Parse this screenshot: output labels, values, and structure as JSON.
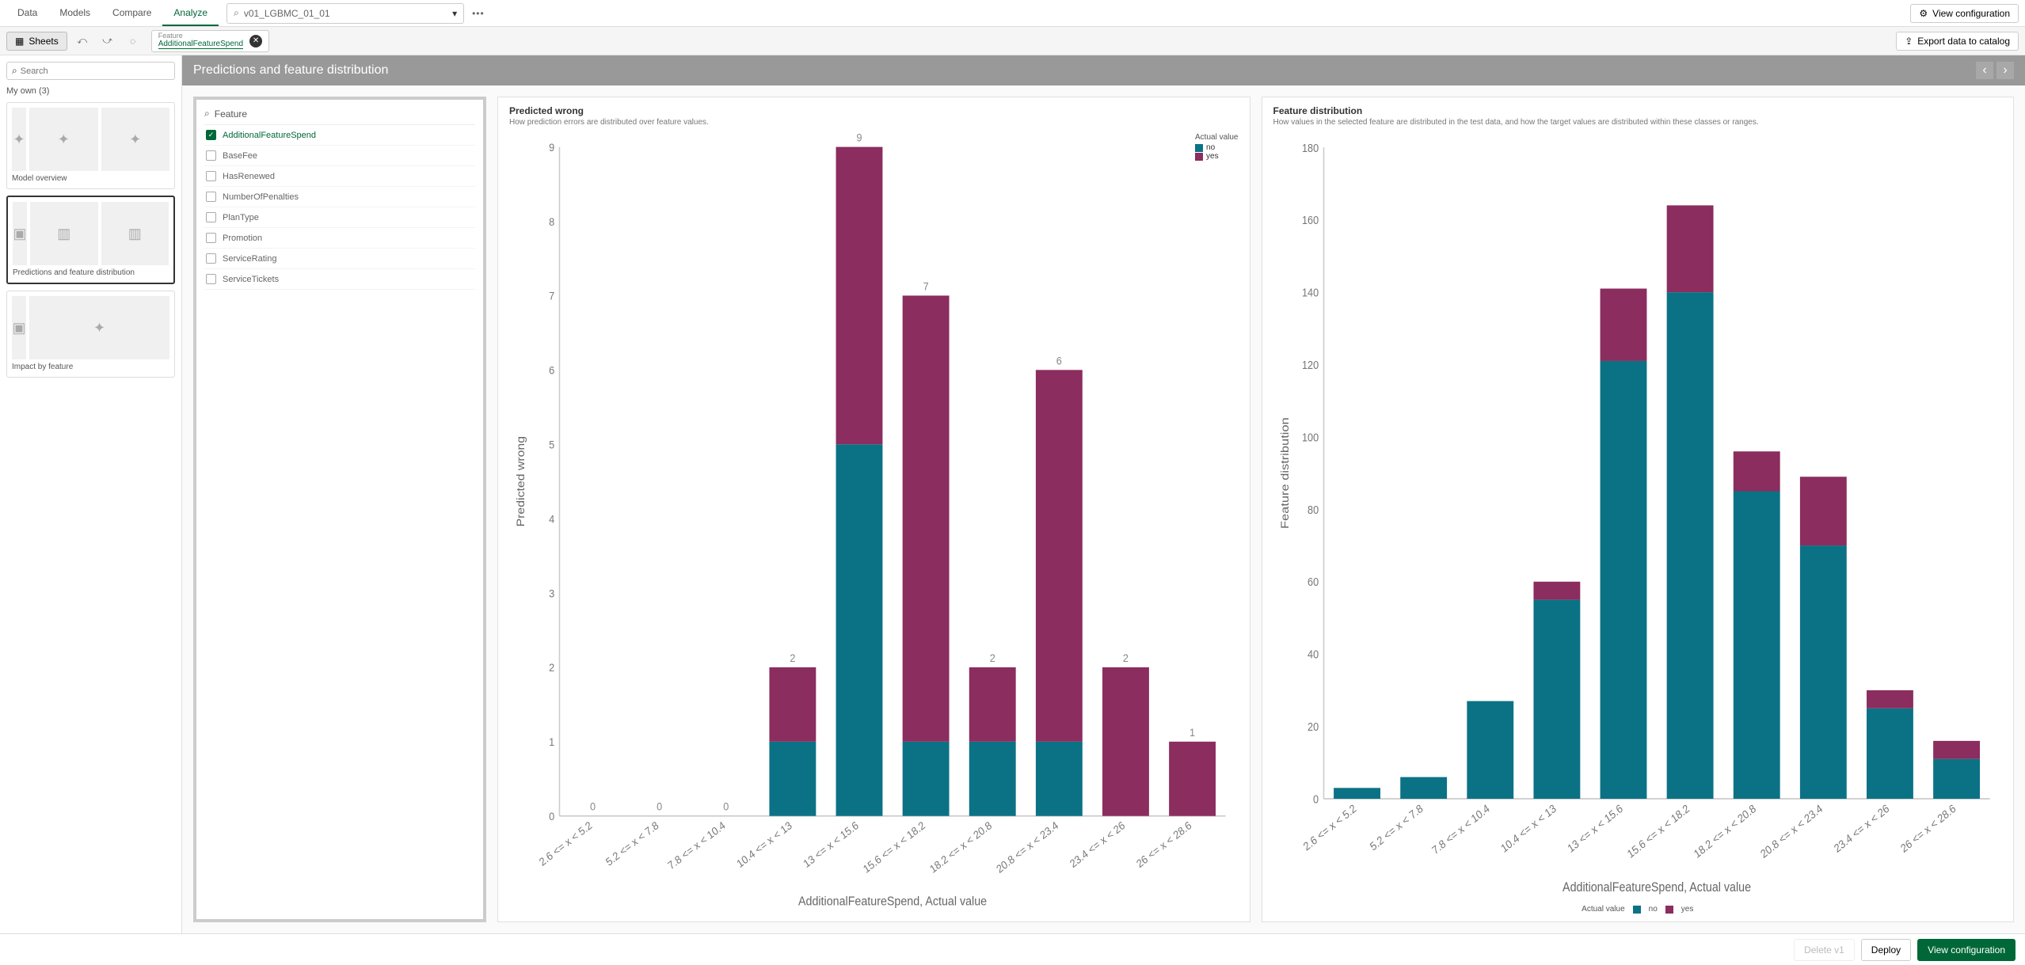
{
  "top_tabs": [
    "Data",
    "Models",
    "Compare",
    "Analyze"
  ],
  "active_top_tab": 3,
  "model_selector_value": "v01_LGBMC_01_01",
  "view_config_label": "View configuration",
  "sheets_btn_label": "Sheets",
  "feature_chip": {
    "label": "Feature",
    "value": "AdditionalFeatureSpend"
  },
  "export_label": "Export data to catalog",
  "search_placeholder": "Search",
  "myown_label": "My own (3)",
  "sheet_cards": [
    {
      "title": "Model overview"
    },
    {
      "title": "Predictions and feature distribution"
    },
    {
      "title": "Impact by feature"
    }
  ],
  "active_sheet": 1,
  "page_title": "Predictions and feature distribution",
  "feature_panel_header": "Feature",
  "features": [
    {
      "name": "AdditionalFeatureSpend",
      "checked": true
    },
    {
      "name": "BaseFee",
      "checked": false
    },
    {
      "name": "HasRenewed",
      "checked": false
    },
    {
      "name": "NumberOfPenalties",
      "checked": false
    },
    {
      "name": "PlanType",
      "checked": false
    },
    {
      "name": "Promotion",
      "checked": false
    },
    {
      "name": "ServiceRating",
      "checked": false
    },
    {
      "name": "ServiceTickets",
      "checked": false
    }
  ],
  "chart1": {
    "title": "Predicted wrong",
    "subtitle": "How prediction errors are distributed over feature values.",
    "legend_title": "Actual value",
    "xlabel": "AdditionalFeatureSpend, Actual value",
    "ylabel": "Predicted wrong"
  },
  "chart2": {
    "title": "Feature distribution",
    "subtitle": "How values in the selected feature are distributed in the test data, and how the target values are distributed within these classes or ranges.",
    "legend_title": "Actual value",
    "xlabel": "AdditionalFeatureSpend, Actual value",
    "ylabel": "Feature distribution"
  },
  "legend_items": [
    {
      "key": "no",
      "label": "no",
      "color": "#0b7285"
    },
    {
      "key": "yes",
      "label": "yes",
      "color": "#8b2d5e"
    }
  ],
  "footer": {
    "delete": "Delete v1",
    "deploy": "Deploy",
    "view_config": "View configuration"
  },
  "chart_data": [
    {
      "type": "bar",
      "title": "Predicted wrong",
      "xlabel": "AdditionalFeatureSpend, Actual value",
      "ylabel": "Predicted wrong",
      "ylim": [
        0,
        9
      ],
      "categories": [
        "2.6 <= x < 5.2",
        "5.2 <= x < 7.8",
        "7.8 <= x < 10.4",
        "10.4 <= x < 13",
        "13 <= x < 15.6",
        "15.6 <= x < 18.2",
        "18.2 <= x < 20.8",
        "20.8 <= x < 23.4",
        "23.4 <= x < 26",
        "26 <= x < 28.6"
      ],
      "series": [
        {
          "name": "no",
          "values": [
            0,
            0,
            0,
            1,
            5,
            1,
            1,
            1,
            0,
            0
          ]
        },
        {
          "name": "yes",
          "values": [
            0,
            0,
            0,
            1,
            4,
            6,
            1,
            5,
            2,
            1
          ]
        }
      ],
      "totals": [
        0,
        0,
        0,
        2,
        9,
        7,
        2,
        6,
        2,
        1
      ]
    },
    {
      "type": "bar",
      "title": "Feature distribution",
      "xlabel": "AdditionalFeatureSpend, Actual value",
      "ylabel": "Feature distribution",
      "ylim": [
        0,
        180
      ],
      "categories": [
        "2.6 <= x < 5.2",
        "5.2 <= x < 7.8",
        "7.8 <= x < 10.4",
        "10.4 <= x < 13",
        "13 <= x < 15.6",
        "15.6 <= x < 18.2",
        "18.2 <= x < 20.8",
        "20.8 <= x < 23.4",
        "23.4 <= x < 26",
        "26 <= x < 28.6"
      ],
      "series": [
        {
          "name": "no",
          "values": [
            3,
            6,
            27,
            55,
            121,
            140,
            85,
            70,
            25,
            11
          ]
        },
        {
          "name": "yes",
          "values": [
            0,
            0,
            0,
            5,
            20,
            24,
            11,
            19,
            5,
            5
          ]
        }
      ],
      "totals": [
        3,
        6,
        27,
        60,
        141,
        164,
        96,
        89,
        30,
        16
      ]
    }
  ]
}
